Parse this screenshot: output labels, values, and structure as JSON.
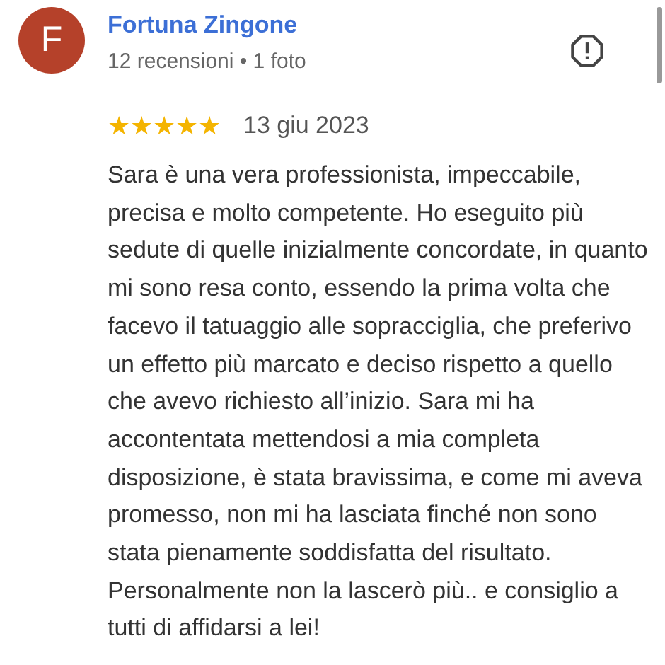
{
  "review": {
    "avatar_letter": "F",
    "author": "Fortuna Zingone",
    "meta": "12 recensioni • 1 foto",
    "stars": 5,
    "date": "13 giu 2023",
    "text": "Sara è una vera professionista, impeccabile, precisa e molto competente. Ho eseguito più sedute di quelle inizialmente concordate, in quanto mi sono resa conto, essendo la prima volta che facevo il tatuaggio alle sopracciglia, che preferivo un effetto più marcato e deciso rispetto a quello che avevo richiesto all’inizio. Sara mi ha accontentata mettendosi a mia completa disposizione, è stata bravissima, e come mi aveva promesso, non mi ha lasciata finché non sono stata pienamente soddisfatta del risultato. Personalmente non la lascerò più.. e consiglio a tutti di affidarsi a lei!"
  }
}
